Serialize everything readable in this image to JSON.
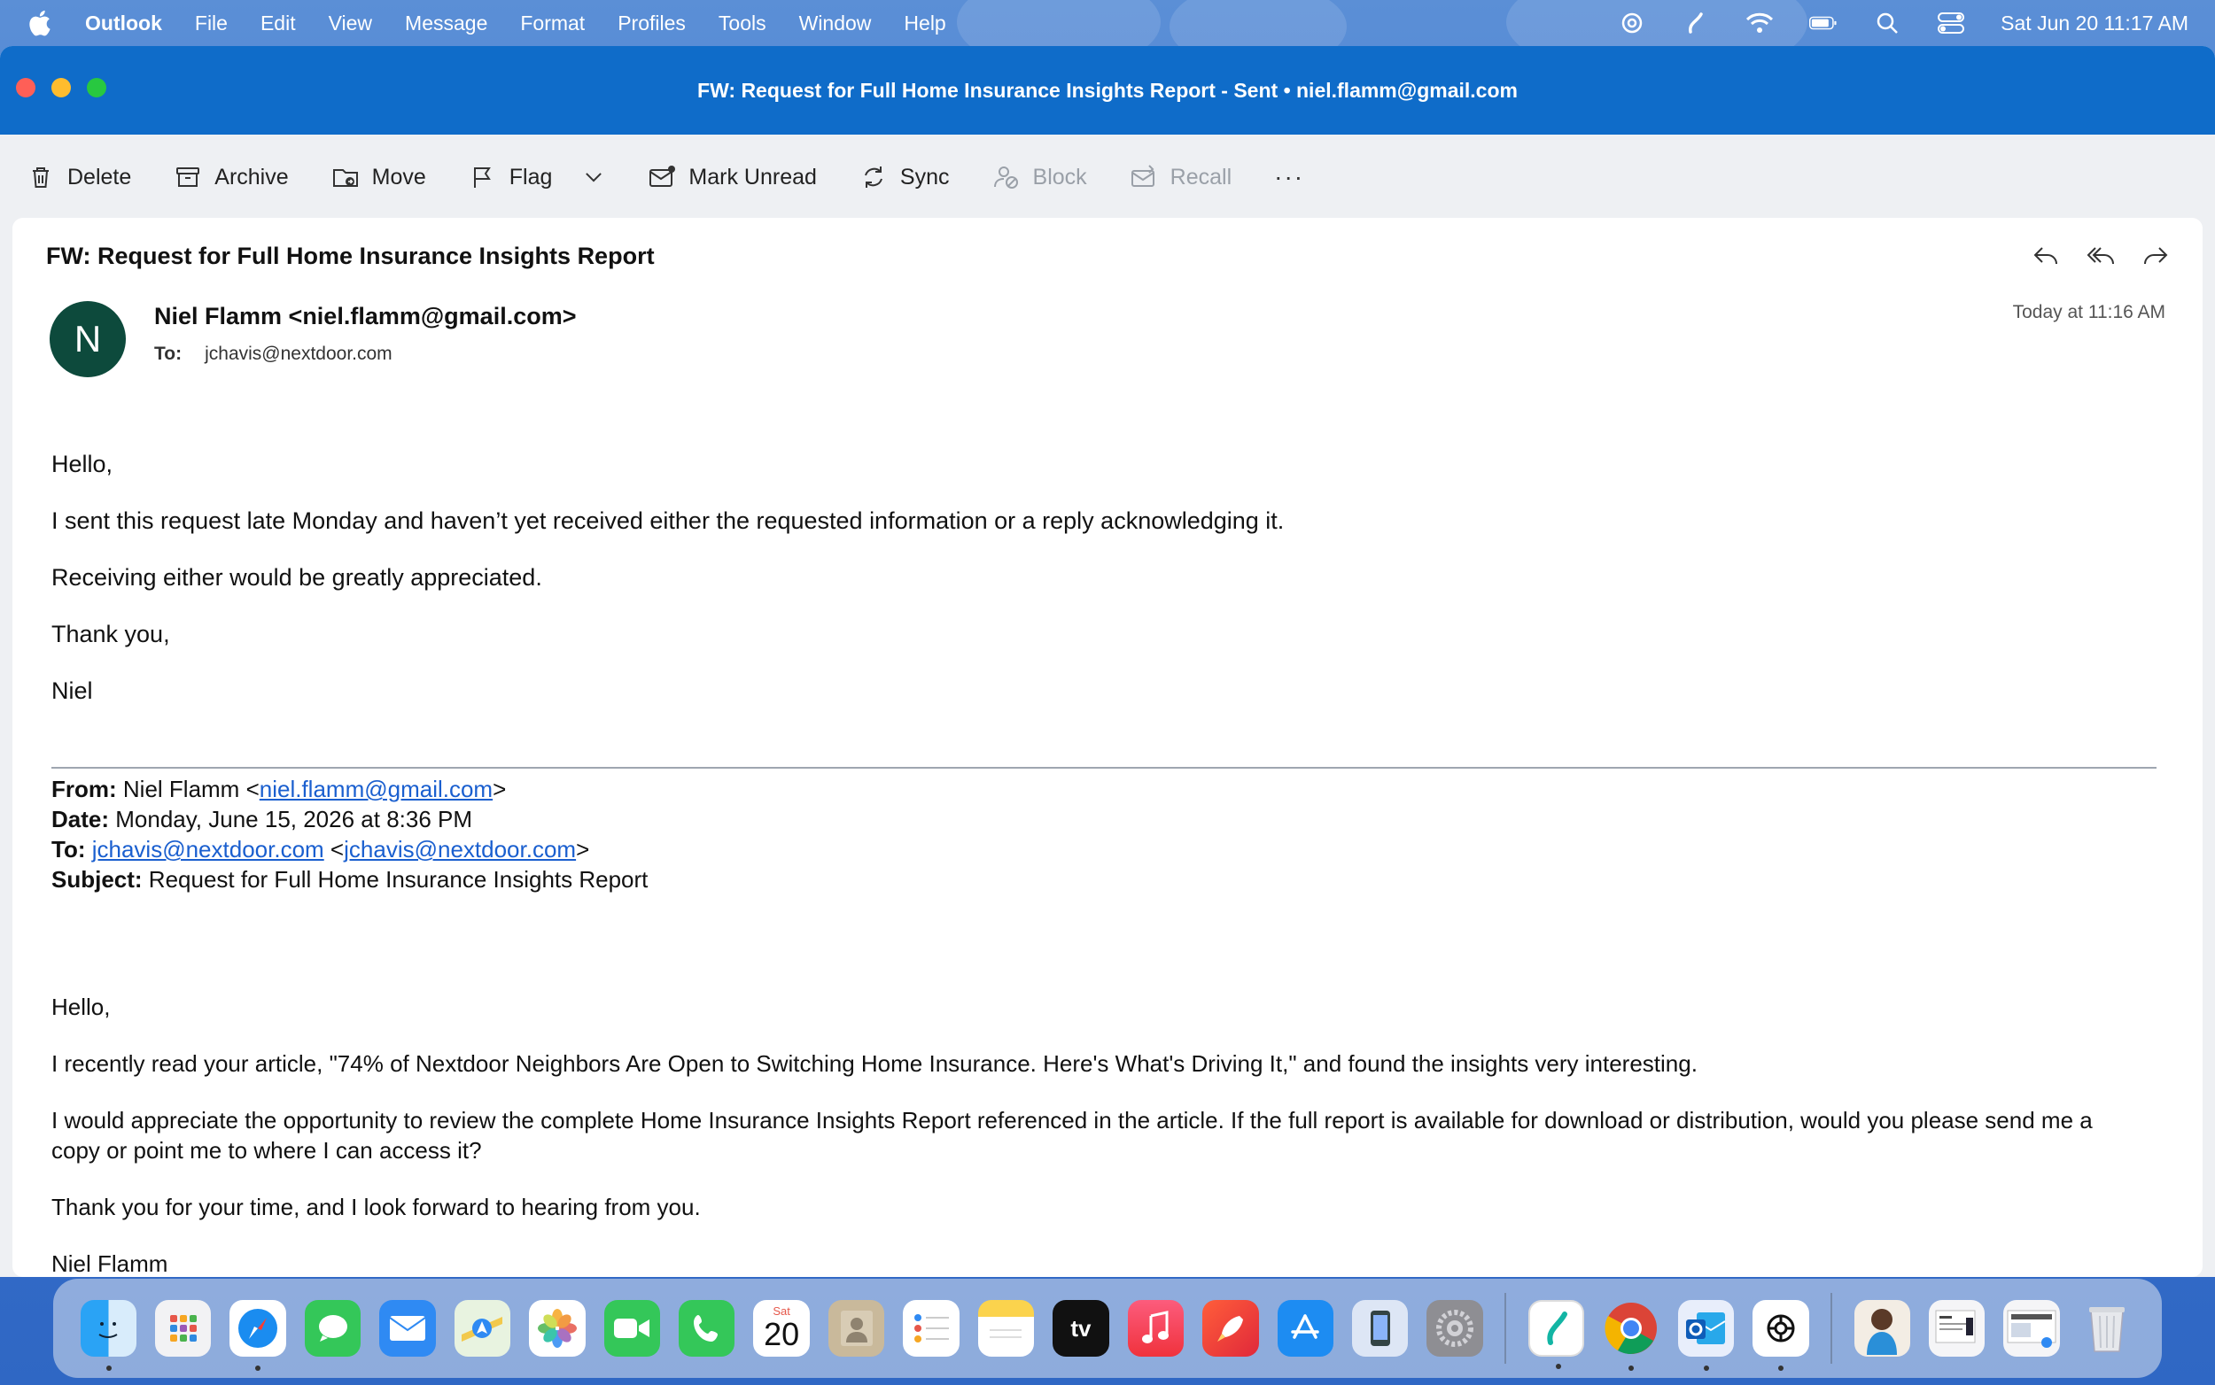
{
  "menubar": {
    "app_name": "Outlook",
    "items": [
      "File",
      "Edit",
      "View",
      "Message",
      "Format",
      "Profiles",
      "Tools",
      "Window",
      "Help"
    ],
    "clock": "Sat Jun 20  11:17 AM"
  },
  "window": {
    "title": "FW: Request for Full Home Insurance Insights Report - Sent • niel.flamm@gmail.com"
  },
  "toolbar": {
    "delete": "Delete",
    "archive": "Archive",
    "move": "Move",
    "flag": "Flag",
    "mark_unread": "Mark Unread",
    "sync": "Sync",
    "block": "Block",
    "recall": "Recall",
    "more": "···"
  },
  "message": {
    "subject": "FW: Request for Full Home Insurance Insights Report",
    "avatar_initial": "N",
    "sender": "Niel Flamm <niel.flamm@gmail.com>",
    "to_label": "To:",
    "to": "jchavis@nextdoor.com",
    "timestamp": "Today at 11:16 AM",
    "body": [
      "Hello,",
      "I sent this request late Monday and haven’t yet received either the requested information or a reply acknowledging it.",
      "Receiving either would be greatly appreciated.",
      "Thank you,",
      "Niel"
    ],
    "forwarded": {
      "from_label": "From:",
      "from_name": " Niel Flamm <",
      "from_email": "niel.flamm@gmail.com",
      "from_close": ">",
      "date_label": "Date:",
      "date": " Monday, June 15, 2026 at 8:36 PM",
      "to_label": "To:",
      "to_email": "jchavis@nextdoor.com",
      "to_mid": " <",
      "to_email2": "jchavis@nextdoor.com",
      "to_close": ">",
      "subject_label": "Subject:",
      "subject": " Request for Full Home Insurance Insights Report",
      "body": [
        "Hello,",
        "I recently read your article, \"74% of Nextdoor Neighbors Are Open to Switching Home Insurance. Here's What's Driving It,\" and found the insights very interesting.",
        "I would appreciate the opportunity to review the complete Home Insurance Insights Report referenced in the article. If the full report is available for download or distribution, would you please send me a copy or point me to where I can access it?",
        "Thank you for your time, and I look forward to hearing from you.",
        "Niel Flamm"
      ]
    }
  },
  "dock": {
    "apps": [
      "finder-icon",
      "launchpad-icon",
      "safari-icon",
      "messages-icon",
      "mail-icon",
      "maps-icon",
      "photos-icon",
      "facetime-icon",
      "phone-icon",
      "calendar-icon",
      "contacts-icon",
      "reminders-icon",
      "notes-icon",
      "tv-icon",
      "music-icon",
      "rocket-icon",
      "app-store-icon",
      "simulator-icon",
      "system-settings-icon",
      "surfshark-icon",
      "chrome-icon",
      "outlook-icon",
      "chatgpt-icon"
    ],
    "calendar_day": "Sat",
    "calendar_date": "20",
    "tv_label": "tv"
  }
}
